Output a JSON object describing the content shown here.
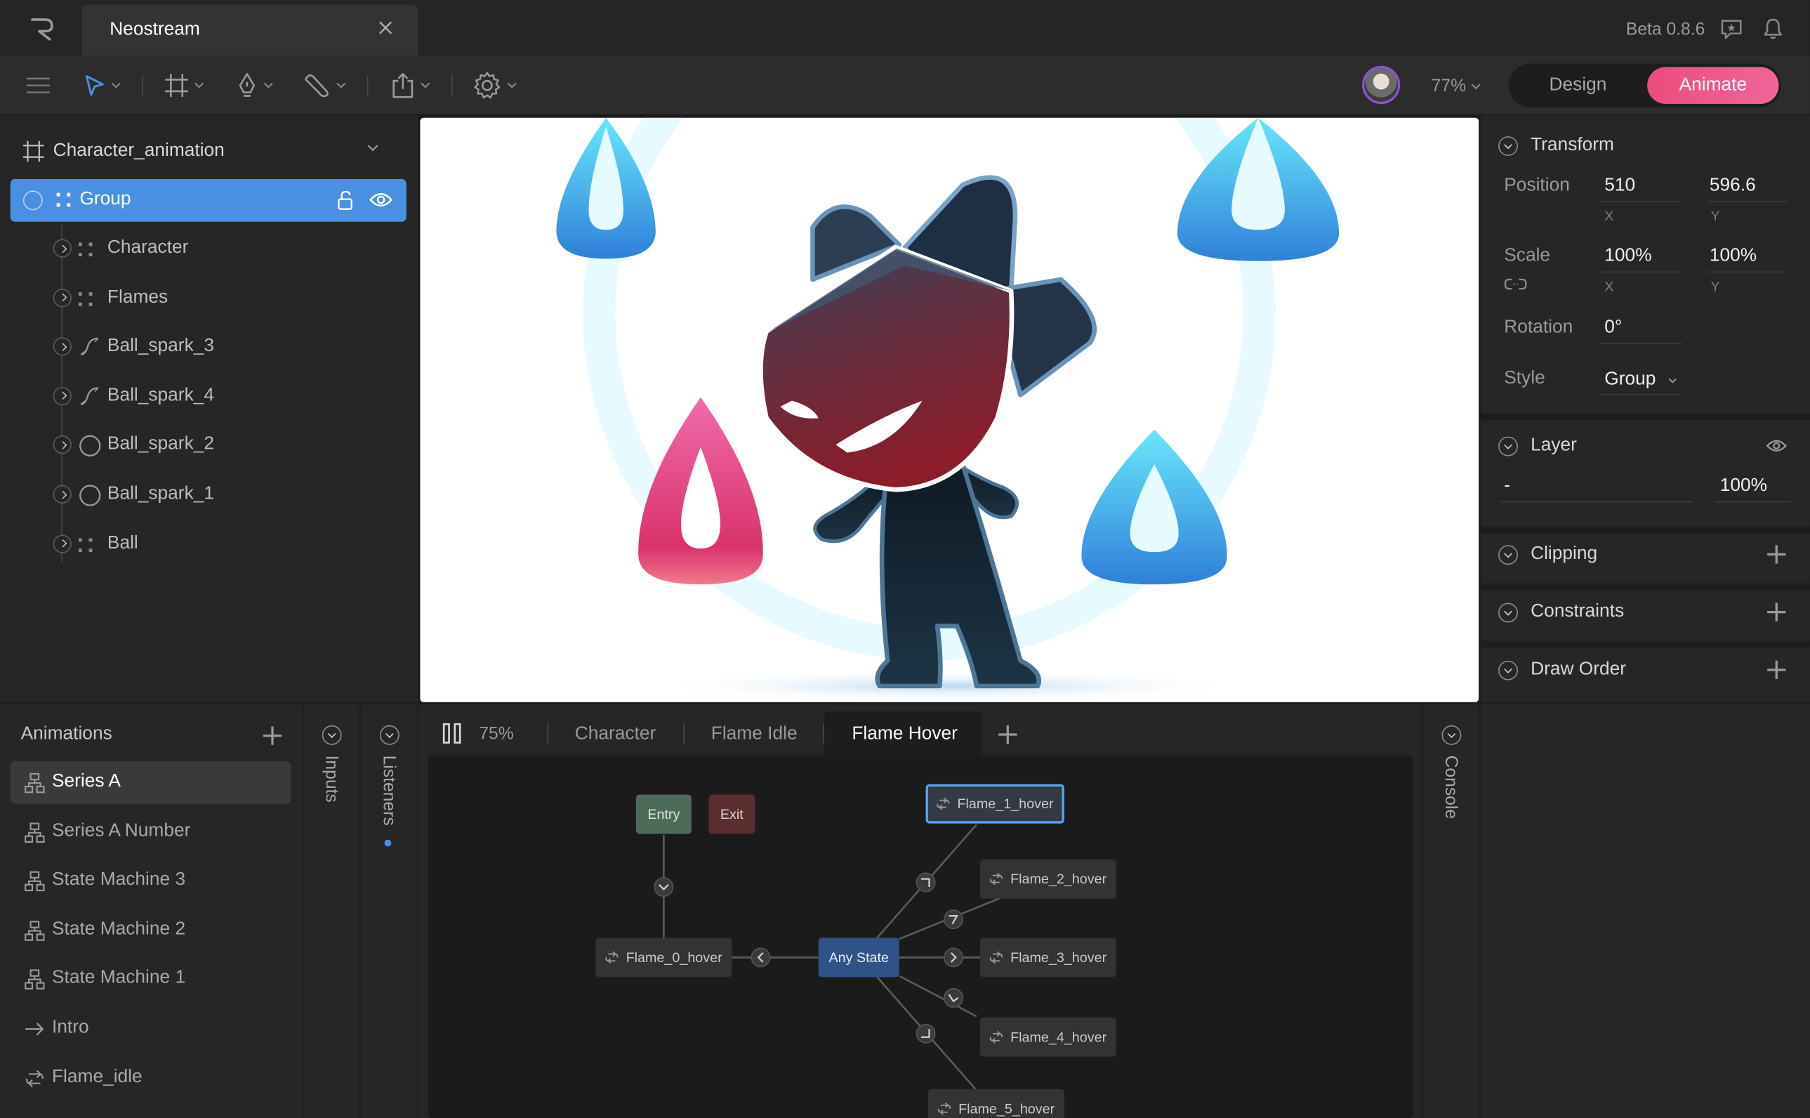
{
  "app": {
    "document_tab": "Neostream",
    "version": "Beta 0.8.6",
    "zoom": "77%",
    "modes": {
      "design": "Design",
      "animate": "Animate",
      "active": "Animate"
    },
    "accent": "#4a90e2",
    "animate_color": "#e94d7c"
  },
  "hierarchy": {
    "artboard": "Character_animation",
    "selected": "Group",
    "layers": [
      {
        "label": "Character",
        "icon": "group-icon"
      },
      {
        "label": "Flames",
        "icon": "group-icon"
      },
      {
        "label": "Ball_spark_3",
        "icon": "path-icon"
      },
      {
        "label": "Ball_spark_4",
        "icon": "path-icon"
      },
      {
        "label": "Ball_spark_2",
        "icon": "ellipse-icon"
      },
      {
        "label": "Ball_spark_1",
        "icon": "ellipse-icon"
      },
      {
        "label": "Ball",
        "icon": "group-icon"
      }
    ]
  },
  "inspector": {
    "transform": {
      "title": "Transform",
      "position_label": "Position",
      "position_x": "510",
      "position_y": "596.6",
      "x_label": "X",
      "y_label": "Y",
      "scale_label": "Scale",
      "scale_x": "100%",
      "scale_y": "100%",
      "rotation_label": "Rotation",
      "rotation": "0°",
      "style_label": "Style",
      "style": "Group"
    },
    "layer": {
      "title": "Layer",
      "blend": "-",
      "opacity": "100%"
    },
    "clipping": "Clipping",
    "constraints": "Constraints",
    "draw_order": "Draw Order"
  },
  "animations": {
    "title": "Animations",
    "items": [
      {
        "label": "Series A",
        "icon": "state-machine-icon"
      },
      {
        "label": "Series A Number",
        "icon": "state-machine-icon"
      },
      {
        "label": "State Machine 3",
        "icon": "state-machine-icon"
      },
      {
        "label": "State Machine 2",
        "icon": "state-machine-icon"
      },
      {
        "label": "State Machine 1",
        "icon": "state-machine-icon"
      },
      {
        "label": "Intro",
        "icon": "arrow-right-icon"
      },
      {
        "label": "Flame_idle",
        "icon": "loop-icon"
      }
    ]
  },
  "side_tabs": {
    "inputs": "Inputs",
    "listeners": "Listeners",
    "console": "Console"
  },
  "state_graph": {
    "speed": "75%",
    "tabs": [
      "Character",
      "Flame Idle",
      "Flame Hover"
    ],
    "active_tab": "Flame Hover",
    "nodes": {
      "entry": "Entry",
      "exit": "Exit",
      "any_state": "Any State",
      "flame_0": "Flame_0_hover",
      "flame_1": "Flame_1_hover",
      "flame_2": "Flame_2_hover",
      "flame_3": "Flame_3_hover",
      "flame_4": "Flame_4_hover",
      "flame_5": "Flame_5_hover"
    }
  }
}
